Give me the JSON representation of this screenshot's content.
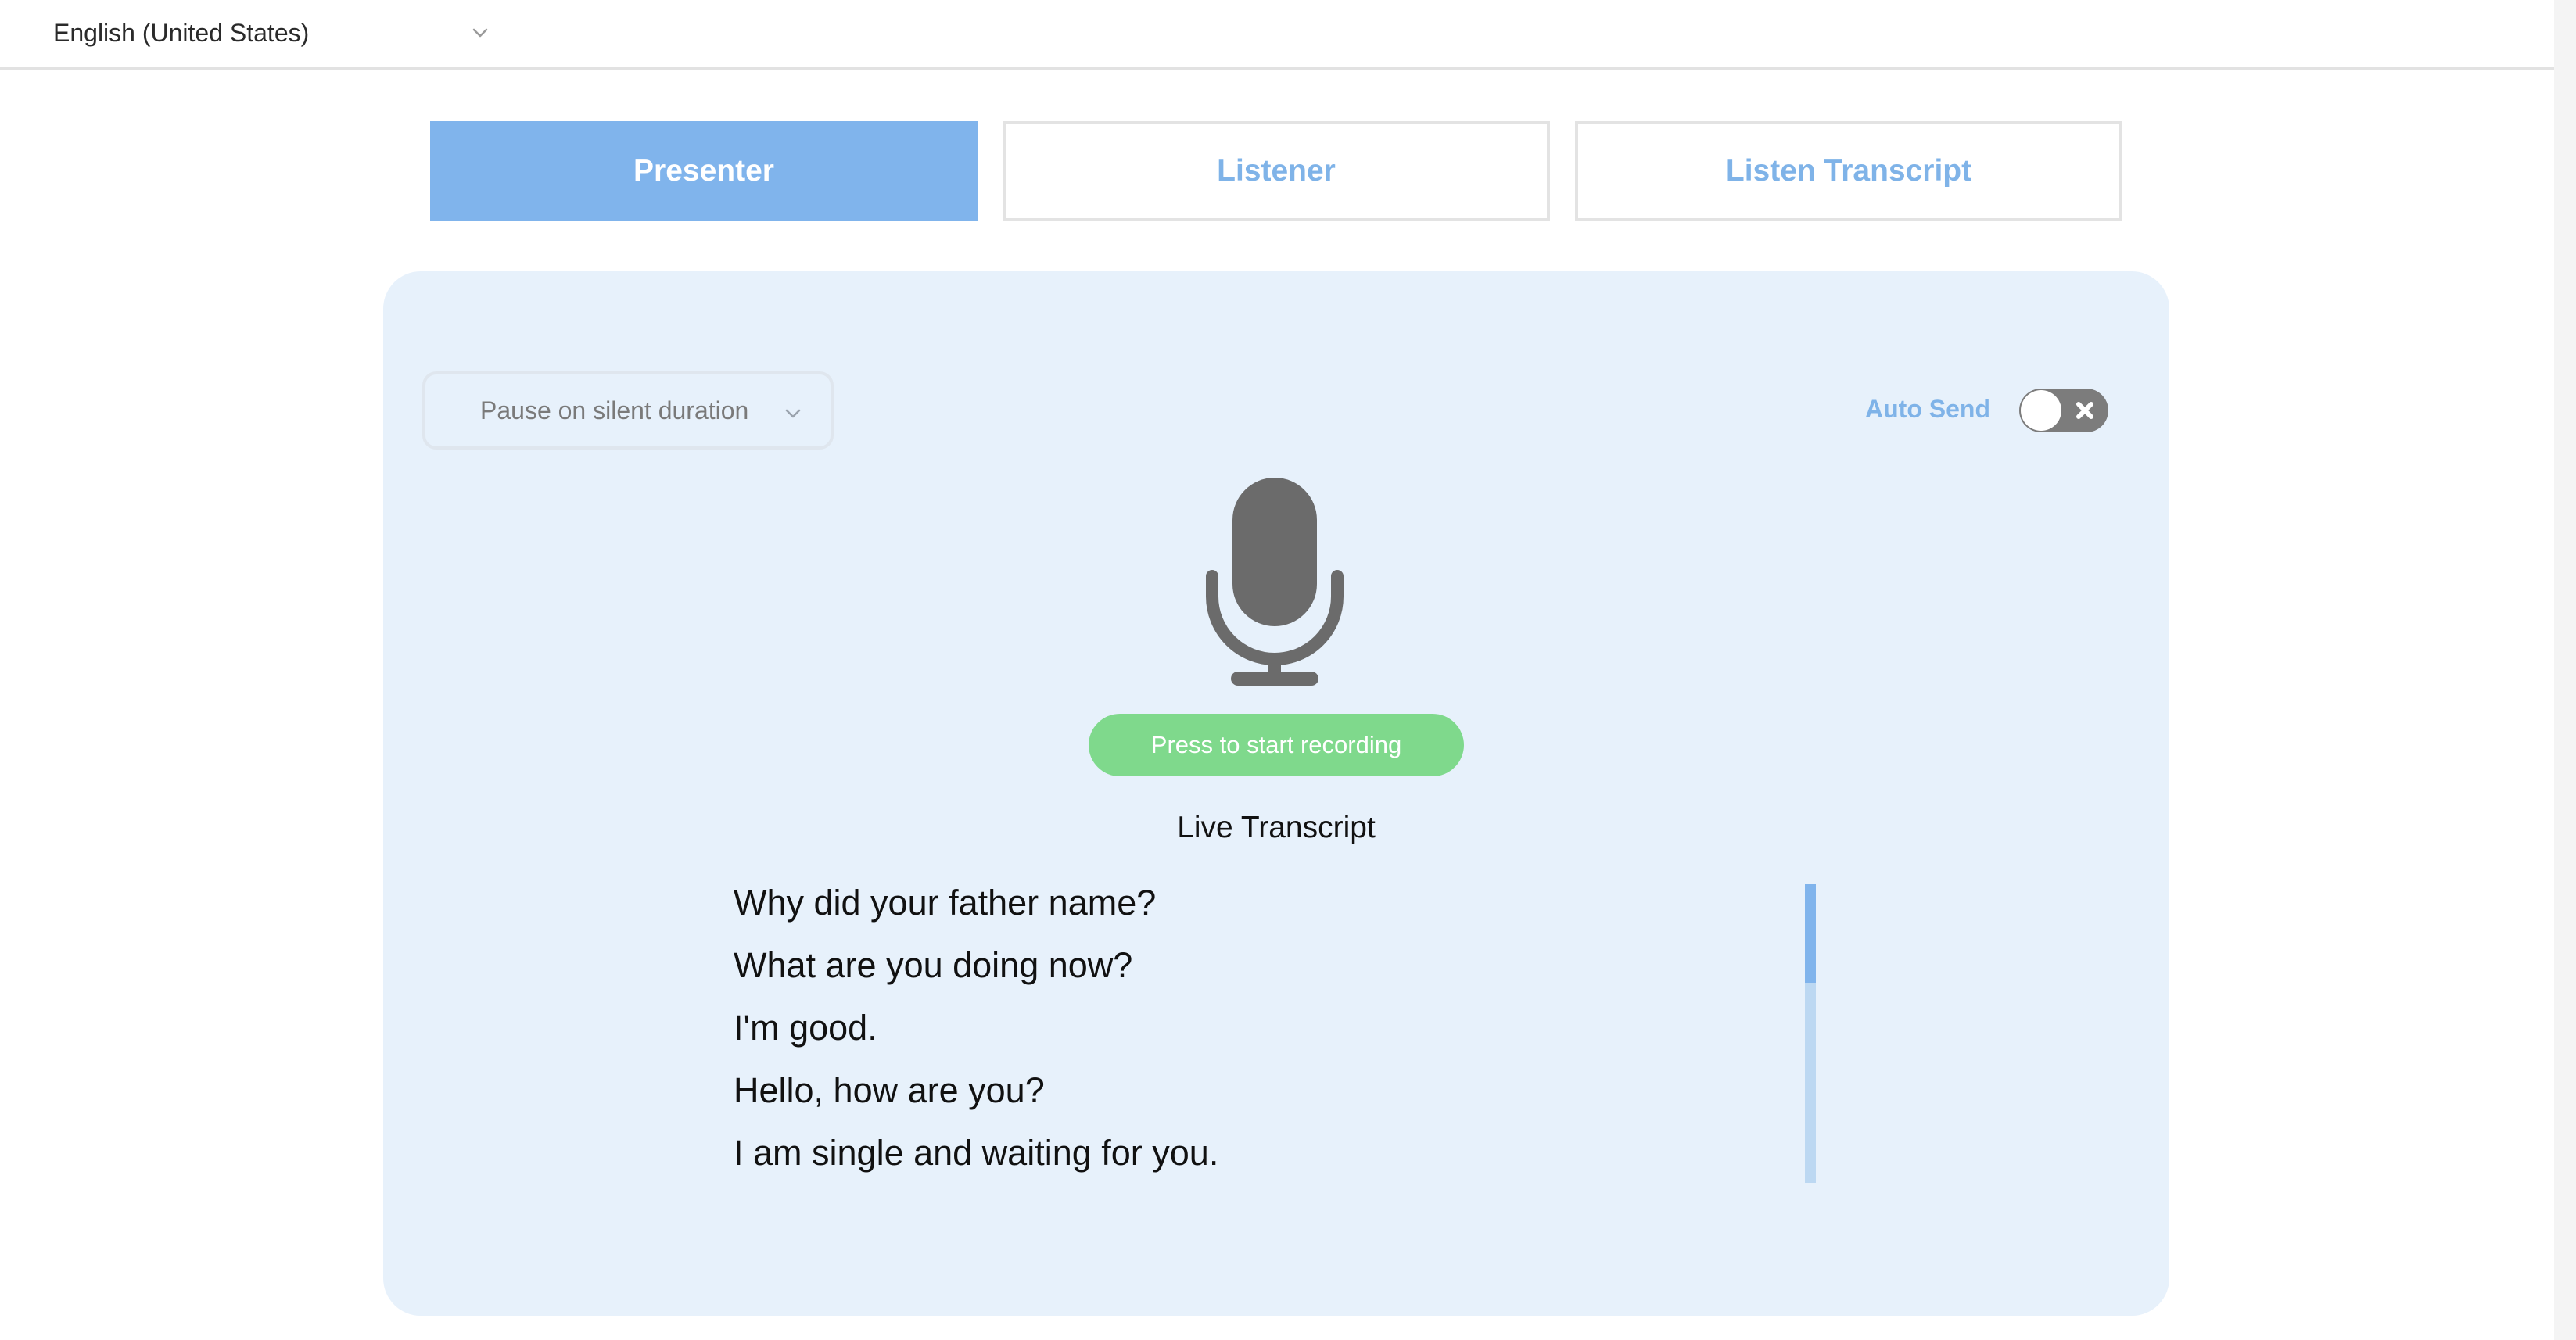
{
  "language_select": {
    "value": "English (United States)",
    "icon": "chevron-down-icon"
  },
  "tabs": [
    {
      "label": "Presenter",
      "active": true
    },
    {
      "label": "Listener",
      "active": false
    },
    {
      "label": "Listen Transcript",
      "active": false
    }
  ],
  "panel": {
    "pause_select": {
      "placeholder": "Pause on silent duration",
      "icon": "chevron-down-icon"
    },
    "auto_send": {
      "label": "Auto Send",
      "enabled": false
    },
    "microphone_icon": "microphone-icon",
    "record_button": "Press to start recording",
    "live_transcript": {
      "title": "Live Transcript",
      "lines": [
        "Why did your father name?",
        "What are you doing now?",
        "I'm good.",
        "Hello, how are you?",
        "I am single and waiting for you."
      ]
    }
  },
  "colors": {
    "accent": "#80b4ec",
    "panel_bg": "#e7f1fb",
    "record_button": "#7fd98c",
    "toggle_off": "#7c7c7c",
    "mic_icon": "#6b6b6b"
  }
}
